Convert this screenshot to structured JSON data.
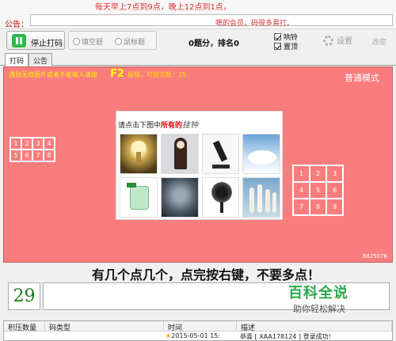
{
  "notice": {
    "label": "公告：",
    "marquee": "每天早上7点到9点，晚上12点到1点，",
    "tail": "嗯的会员，码很多易打。"
  },
  "toolbar": {
    "stop_label": "停止打码",
    "radio_fill": "填空题",
    "radio_mouse": "鼠标题",
    "score": "0题分，排名0",
    "check_sound": "响铃",
    "check_top": "置顶",
    "settings_label": "设置",
    "change_label": "改密"
  },
  "tabs": [
    {
      "label": "打码"
    },
    {
      "label": "公告"
    }
  ],
  "panel": {
    "background": "#fa7d7d",
    "warning": "遇到无效图片或者不能输入请按",
    "f2": "F2",
    "tries": "报错，可按次数：25",
    "mode": "普通模式",
    "code": "6825076",
    "left_grid": [
      "1",
      "2",
      "3",
      "4",
      "5",
      "6",
      "7",
      "8"
    ],
    "right_grid": [
      "1",
      "2",
      "3",
      "4",
      "5",
      "6",
      "7",
      "8",
      "9"
    ]
  },
  "captcha": {
    "prompt_prefix": "请点击下图中",
    "prompt_emphasis": "所有的",
    "prompt_target": "挂钟"
  },
  "instruction": "有几个点几个，点完按右键，不要多点！",
  "count": "29",
  "table": {
    "headers": [
      "积压数量",
      "码类型",
      "时间",
      "描述"
    ],
    "row": {
      "time": "2015-05-01 15:",
      "desc": "恭喜 [ XAA178124 ] 登录成功！"
    }
  },
  "watermark": {
    "title": "百科全说",
    "subtitle": "助你轻松解决"
  }
}
